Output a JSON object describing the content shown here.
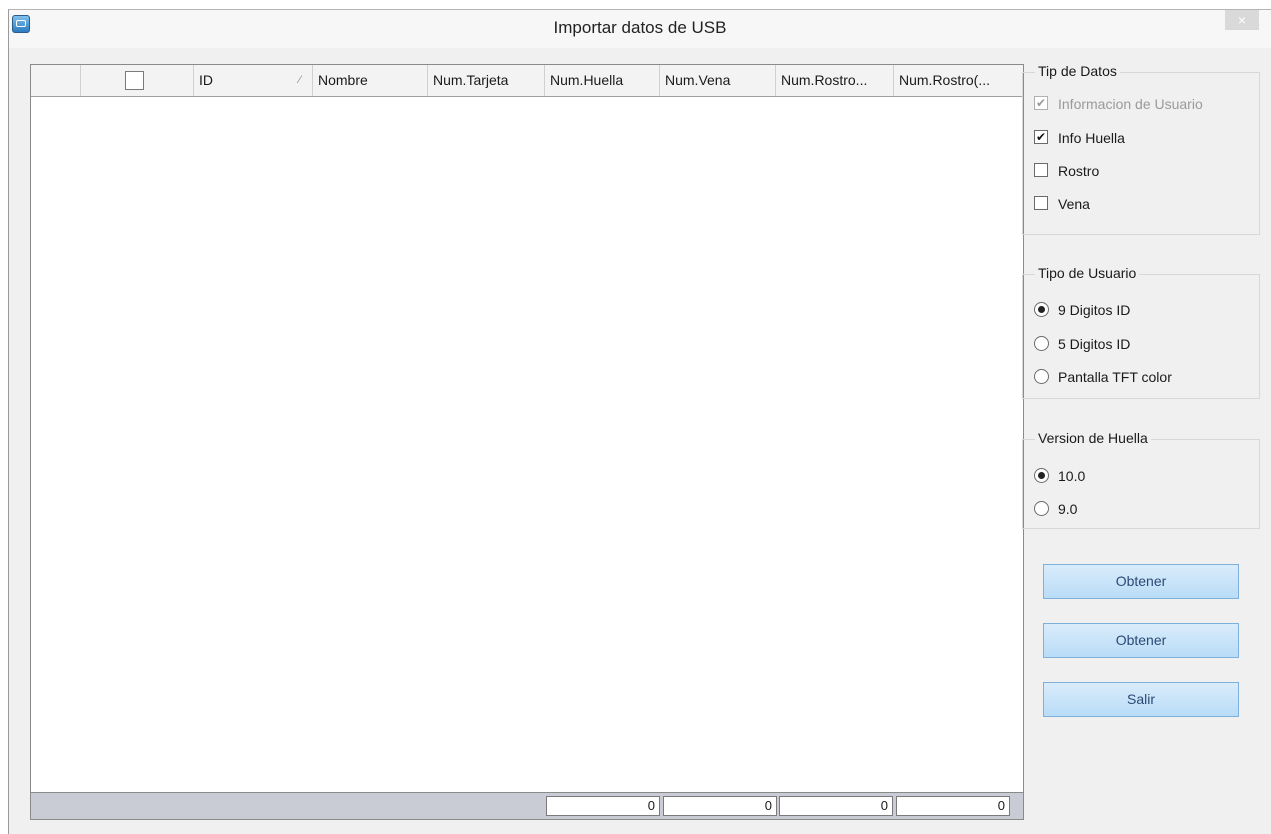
{
  "window": {
    "title": "Importar datos de USB",
    "close_label": "×"
  },
  "grid": {
    "columns": [
      "ID",
      "Nombre",
      "Num.Tarjeta",
      "Num.Huella",
      "Num.Vena",
      "Num.Rostro...",
      "Num.Rostro(..."
    ],
    "sort_indicator": "⁄",
    "footer_totals": [
      "0",
      "0",
      "0",
      "0"
    ]
  },
  "tip_de_datos": {
    "title": "Tip de Datos",
    "options": [
      {
        "label": "Informacion de Usuario",
        "checked": true,
        "disabled": true
      },
      {
        "label": "Info Huella",
        "checked": true,
        "disabled": false
      },
      {
        "label": "Rostro",
        "checked": false,
        "disabled": false
      },
      {
        "label": "Vena",
        "checked": false,
        "disabled": false
      }
    ]
  },
  "tipo_de_usuario": {
    "title": "Tipo de Usuario",
    "options": [
      {
        "label": "9 Digitos ID",
        "selected": true
      },
      {
        "label": "5 Digitos ID",
        "selected": false
      },
      {
        "label": "Pantalla TFT color",
        "selected": false
      }
    ]
  },
  "version_de_huella": {
    "title": "Version de Huella",
    "options": [
      {
        "label": "10.0",
        "selected": true
      },
      {
        "label": "9.0",
        "selected": false
      }
    ]
  },
  "buttons": {
    "obtener_1": "Obtener",
    "obtener_2": "Obtener",
    "salir": "Salir"
  }
}
